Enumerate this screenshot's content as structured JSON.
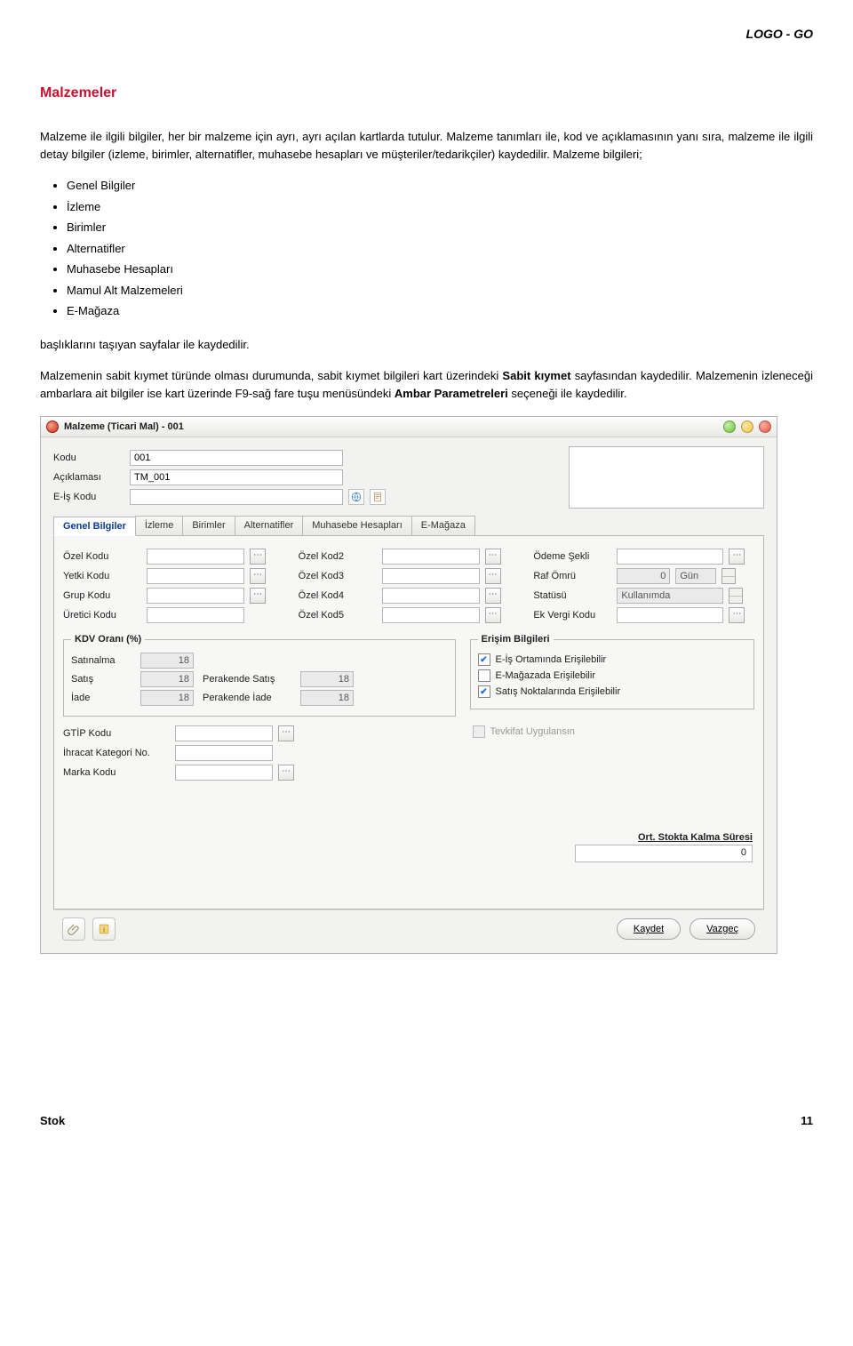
{
  "brand": "LOGO - GO",
  "section_title": "Malzemeler",
  "para1": "Malzeme ile ilgili bilgiler, her bir malzeme için ayrı, ayrı açılan kartlarda tutulur. Malzeme tanımları ile, kod ve açıklamasının yanı sıra, malzeme ile ilgili detay bilgiler (izleme, birimler, alternatifler, muhasebe hesapları ve müşteriler/tedarikçiler) kaydedilir. Malzeme bilgileri;",
  "bullets": [
    "Genel Bilgiler",
    "İzleme",
    "Birimler",
    "Alternatifler",
    "Muhasebe Hesapları",
    "Mamul Alt Malzemeleri",
    "E-Mağaza"
  ],
  "para2": "başlıklarını taşıyan sayfalar ile kaydedilir.",
  "para3_a": "Malzemenin sabit kıymet türünde olması durumunda, sabit kıymet bilgileri kart üzerindeki ",
  "para3_b": "Sabit kıymet",
  "para3_c": " sayfasından kaydedilir. Malzemenin izleneceği ambarlara ait bilgiler ise kart üzerinde F9-sağ fare tuşu menüsündeki ",
  "para3_d": "Ambar Parametreleri",
  "para3_e": " seçeneği ile kaydedilir.",
  "window": {
    "title": "Malzeme (Ticari Mal) - 001",
    "header_labels": {
      "kodu": "Kodu",
      "aciklamasi": "Açıklaması",
      "eiskodu": "E-İş Kodu"
    },
    "header_values": {
      "kodu": "001",
      "aciklamasi": "TM_001",
      "eiskodu": ""
    },
    "tabs": [
      "Genel Bilgiler",
      "İzleme",
      "Birimler",
      "Alternatifler",
      "Muhasebe Hesapları",
      "E-Mağaza"
    ],
    "col1": {
      "ozel_kodu": "Özel Kodu",
      "yetki_kodu": "Yetki Kodu",
      "grup_kodu": "Grup Kodu",
      "uretici_kodu": "Üretici Kodu"
    },
    "col2": {
      "ozel_kod2": "Özel Kod2",
      "ozel_kod3": "Özel Kod3",
      "ozel_kod4": "Özel Kod4",
      "ozel_kod5": "Özel Kod5"
    },
    "col3": {
      "odeme_sekli": "Ödeme Şekli",
      "raf_omru": "Raf Ömrü",
      "raf_omru_val": "0",
      "raf_omru_unit": "Gün",
      "statusu": "Statüsü",
      "statusu_val": "Kullanımda",
      "ek_vergi": "Ek Vergi Kodu"
    },
    "kdv": {
      "legend": "KDV Oranı (%)",
      "satinalma": "Satınalma",
      "satis": "Satış",
      "iade": "İade",
      "perakende_satis": "Perakende Satış",
      "perakende_iade": "Perakende İade",
      "val": "18"
    },
    "erisim": {
      "legend": "Erişim Bilgileri",
      "c1": "E-İş Ortamında Erişilebilir",
      "c2": "E-Mağazada Erişilebilir",
      "c3": "Satış Noktalarında Erişilebilir"
    },
    "tevkifat": "Tevkifat Uygulansın",
    "lower": {
      "gtip": "GTİP Kodu",
      "ihracat": "İhracat Kategori No.",
      "marka": "Marka Kodu"
    },
    "stok_kalma": {
      "title": "Ort. Stokta Kalma Süresi",
      "value": "0"
    },
    "buttons": {
      "kaydet": "Kaydet",
      "vazgec": "Vazgeç"
    },
    "lookup_glyph": "⋯"
  },
  "footer": {
    "left": "Stok",
    "right": "11"
  }
}
